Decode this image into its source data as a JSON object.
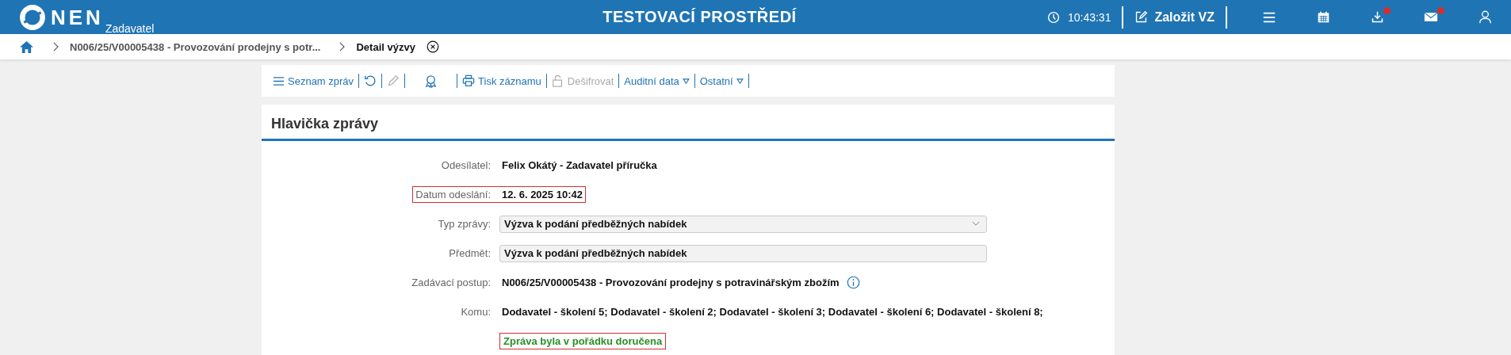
{
  "header": {
    "logo": "NEN",
    "logo_sub": "Zadavatel",
    "title": "TESTOVACÍ PROSTŘEDÍ",
    "clock": "10:43:31",
    "create_button": "Založit VZ",
    "icons": [
      {
        "kind": "menu",
        "badge": false
      },
      {
        "kind": "calendar",
        "badge": false
      },
      {
        "kind": "download",
        "badge": true
      },
      {
        "kind": "mail",
        "badge": true
      },
      {
        "kind": "user",
        "badge": false
      }
    ]
  },
  "breadcrumb": [
    {
      "label": "N006/25/V00005438 - Provozování prodejny s potr...",
      "selected": false
    },
    {
      "label": "Detail výzvy",
      "selected": true
    }
  ],
  "toolbar": [
    {
      "kind": "menu",
      "label": "Seznam zpráv",
      "disabled": false
    },
    {
      "kind": "refresh",
      "disabled": false
    },
    {
      "kind": "edit",
      "disabled": true
    },
    {
      "kind": "award",
      "disabled": false
    },
    {
      "kind": "print",
      "label": "Tisk záznamu",
      "disabled": false
    },
    {
      "kind": "unlock",
      "label": "Dešifrovat",
      "disabled": true
    },
    {
      "kind": "dropdown",
      "label": "Auditní data",
      "disabled": false
    },
    {
      "kind": "dropdown",
      "label": "Ostatní",
      "disabled": false
    }
  ],
  "panel": {
    "title": "Hlavička zprávy",
    "fields": [
      {
        "kind": "text",
        "label": "Odesílatel:",
        "value": "Felix Okátý - Zadavatel příručka",
        "highlighted": false
      },
      {
        "kind": "text",
        "label": "Datum odeslání:",
        "value": "12. 6. 2025 10:42",
        "highlighted": true
      },
      {
        "kind": "select",
        "label": "Typ zprávy:",
        "value": "Výzva k podání předběžných nabídek",
        "highlighted": false
      },
      {
        "kind": "input",
        "label": "Předmět:",
        "value": "Výzva k podání předběžných nabídek",
        "highlighted": false
      },
      {
        "kind": "info",
        "label": "Zadávací postup:",
        "value": "N006/25/V00005438 - Provozování prodejny s potravinářským zbožím",
        "highlighted": false
      },
      {
        "kind": "text",
        "label": "Komu:",
        "value": "Dodavatel - školení 5; Dodavatel - školení 2; Dodavatel - školení 3; Dodavatel - školení 6; Dodavatel - školení 8;",
        "highlighted": false
      }
    ],
    "status": {
      "text": "Zpráva byla v pořádku doručena",
      "highlighted": true
    }
  }
}
